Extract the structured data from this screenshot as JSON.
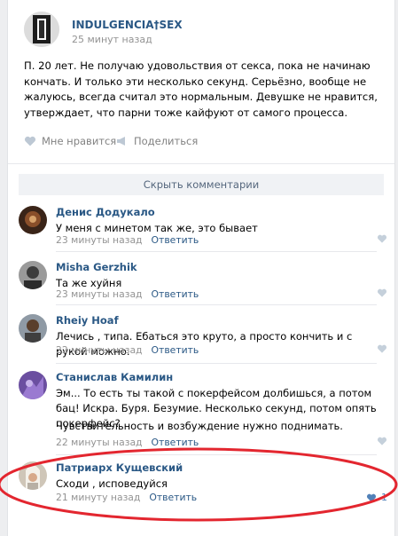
{
  "post": {
    "author": "INDULGENCIA†SEX",
    "time": "25 минут назад",
    "text": "П. 20 лет. Не получаю удовольствия от секса, пока не начинаю кончать. И только эти несколько секунд. Серьёзно, вообще не жалуюсь, всегда считал это нормальным. Девушке не нравится, утверждает, что парни тоже кайфуют от самого процесса.",
    "like_label": "Мне нравится",
    "share_label": "Поделиться"
  },
  "hide_comments_label": "Скрыть комментарии",
  "comments": [
    {
      "name": "Денис Додукало",
      "text": "У меня с минетом так же, это бывает",
      "time": "23 минуты назад",
      "reply": "Ответить"
    },
    {
      "name": "Misha Gerzhik",
      "text": "Та же хуйня",
      "time": "23 минуты назад",
      "reply": "Ответить"
    },
    {
      "name": "Rheiy Hoaf",
      "text": "Лечись , типа. Ебаться это круто, а просто кончить и с рукой можно.",
      "time": "22 минуты назад",
      "reply": "Ответить"
    },
    {
      "name": "Станислав Камилин",
      "text": "Эм... То есть ты такой с покерфейсом долбишься, а потом бац! Искра. Буря. Безумие. Несколько секунд, потом опять покерфейс?",
      "text2": "Чувствительность и возбуждение нужно поднимать.",
      "time": "22 минуты назад",
      "reply": "Ответить"
    },
    {
      "name": "Патриарх Кущевский",
      "text": "Сходи , исповедуйся",
      "time": "21 минуту назад",
      "reply": "Ответить",
      "likes": "1"
    }
  ],
  "colors": {
    "link": "#2a5885",
    "meta": "#939393",
    "highlight": "#e3262f"
  }
}
